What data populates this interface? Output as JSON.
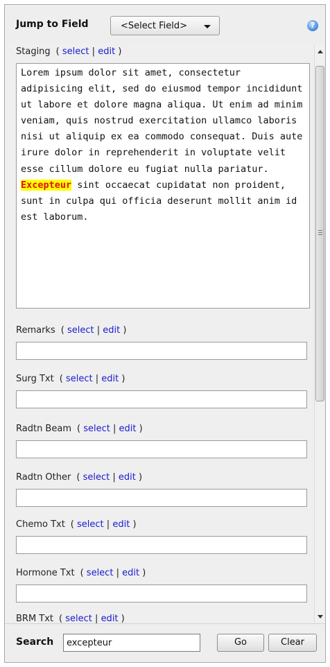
{
  "header": {
    "jump_label": "Jump to Field",
    "select_value": "<Select Field>",
    "help_icon": "help-circle-icon"
  },
  "links": {
    "select": "select",
    "edit": "edit",
    "separator": "|",
    "open": "(",
    "close": ")"
  },
  "staging": {
    "label": "Staging",
    "text_before": "Lorem ipsum dolor sit amet, consectetur adipisicing elit, sed do eiusmod tempor incididunt ut labore et dolore magna aliqua. Ut enim ad minim veniam, quis nostrud exercitation ullamco laboris nisi ut aliquip ex ea commodo consequat. Duis aute irure dolor in reprehenderit in voluptate velit esse cillum dolore eu fugiat nulla pariatur. ",
    "text_highlight": "Excepteur",
    "text_after": " sint occaecat cupidatat non proident, sunt in culpa qui officia deserunt mollit anim id est laborum."
  },
  "fields": [
    {
      "label": "Remarks",
      "value": ""
    },
    {
      "label": "Surg Txt",
      "value": ""
    },
    {
      "label": "Radtn Beam",
      "value": ""
    },
    {
      "label": "Radtn Other",
      "value": ""
    },
    {
      "label": "Chemo Txt",
      "value": ""
    },
    {
      "label": "Hormone Txt",
      "value": ""
    },
    {
      "label": "BRM Txt",
      "value": ""
    }
  ],
  "footer": {
    "search_label": "Search",
    "search_value": "excepteur",
    "go_label": "Go",
    "clear_label": "Clear"
  },
  "colors": {
    "link": "#1a1ad2",
    "highlight_bg": "#ffff00",
    "highlight_text": "#e01010"
  }
}
